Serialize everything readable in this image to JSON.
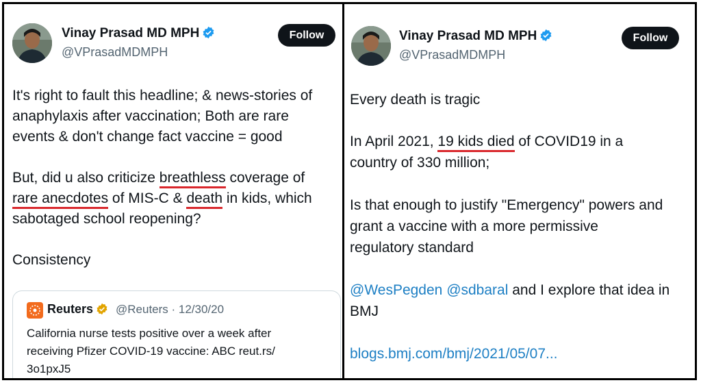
{
  "left_tweet": {
    "author_name": "Vinay Prasad MD MPH",
    "author_handle": "@VPrasadMDMPH",
    "follow_label": "Follow",
    "body_lines": [
      "It's right to fault this headline; & news-stories of",
      "anaphylaxis after vaccination; Both are rare",
      "events & don't change fact vaccine = good"
    ],
    "para2": {
      "l1_a": "But, did u also criticize ",
      "l1_b": "breathless",
      "l1_c": " coverage of",
      "l2_a": "rare anecdotes",
      "l2_b": " of MIS-C & ",
      "l2_c": "death",
      "l2_d": " in kids, which",
      "l3": "sabotaged school reopening?"
    },
    "para3": "Consistency",
    "quote": {
      "name": "Reuters",
      "handle_date": "@Reuters · 12/30/20",
      "lines": [
        "California nurse tests positive over a week after",
        "receiving Pfizer COVID-19 vaccine: ABC reut.rs/",
        "3o1pxJ5"
      ]
    }
  },
  "right_tweet": {
    "author_name": "Vinay Prasad MD MPH",
    "author_handle": "@VPrasadMDMPH",
    "follow_label": "Follow",
    "para1": "Every death is tragic",
    "para2": {
      "l1_a": "In April 2021, ",
      "l1_b": "19 kids died",
      "l1_c": " of COVID19 in a",
      "l2": "country of 330 million;"
    },
    "para3": [
      "Is that enough to justify \"Emergency\" powers and",
      "grant a vaccine with a more permissive",
      "regulatory standard"
    ],
    "para4": {
      "mention1": "@WesPegden",
      "mention2": "@sdbaral",
      "rest": " and I explore that idea in",
      "l2": "BMJ"
    },
    "link": "blogs.bmj.com/bmj/2021/05/07..."
  },
  "colors": {
    "link": "#1d7fc4",
    "underline": "#d9262b",
    "verified": "#1d9bf0",
    "reuters_badge": "#e2a400"
  }
}
